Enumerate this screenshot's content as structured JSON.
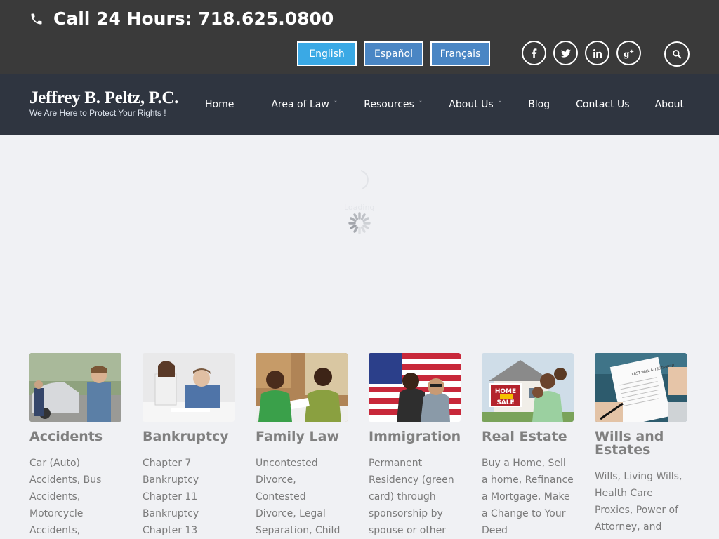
{
  "topbar": {
    "phone_text": "Call 24 Hours: 718.625.0800",
    "languages": [
      "English",
      "Español",
      "Français"
    ],
    "social": [
      "facebook-icon",
      "twitter-icon",
      "linkedin-icon",
      "google-plus-icon"
    ],
    "search_icon": "search-icon"
  },
  "nav": {
    "brand_name": "Jeffrey B. Peltz, P.C.",
    "brand_tagline": "We Are Here to Protect Your Rights !",
    "items": [
      "Home",
      "Area of Law",
      "Resources",
      "About Us",
      "Blog",
      "Contact Us",
      "About"
    ]
  },
  "loader": {
    "text": "Loading"
  },
  "cards": [
    {
      "title": "Accidents",
      "text": "Car (Auto) Accidents, Bus Accidents, Motorcycle Accidents,"
    },
    {
      "title": "Bankruptcy",
      "text": "Chapter 7 Bankruptcy Chapter 11 Bankruptcy Chapter 13"
    },
    {
      "title": "Family Law",
      "text": "Uncontested Divorce, Contested Divorce, Legal Separation, Child"
    },
    {
      "title": "Immigration",
      "text": "Permanent Residency (green card) through sponsorship by spouse or other"
    },
    {
      "title": "Real Estate",
      "text": "Buy a Home, Sell a home, Refinance a Mortgage, Make a Change to Your Deed"
    },
    {
      "title": "Wills and Estates",
      "text": "Wills, Living Wills, Health Care Proxies, Power of Attorney, and"
    }
  ],
  "colors": {
    "topbar": "#3a3a3a",
    "nav": "#2f3540",
    "lang_active": "#3aa9e5",
    "lang": "#4a86c4"
  }
}
